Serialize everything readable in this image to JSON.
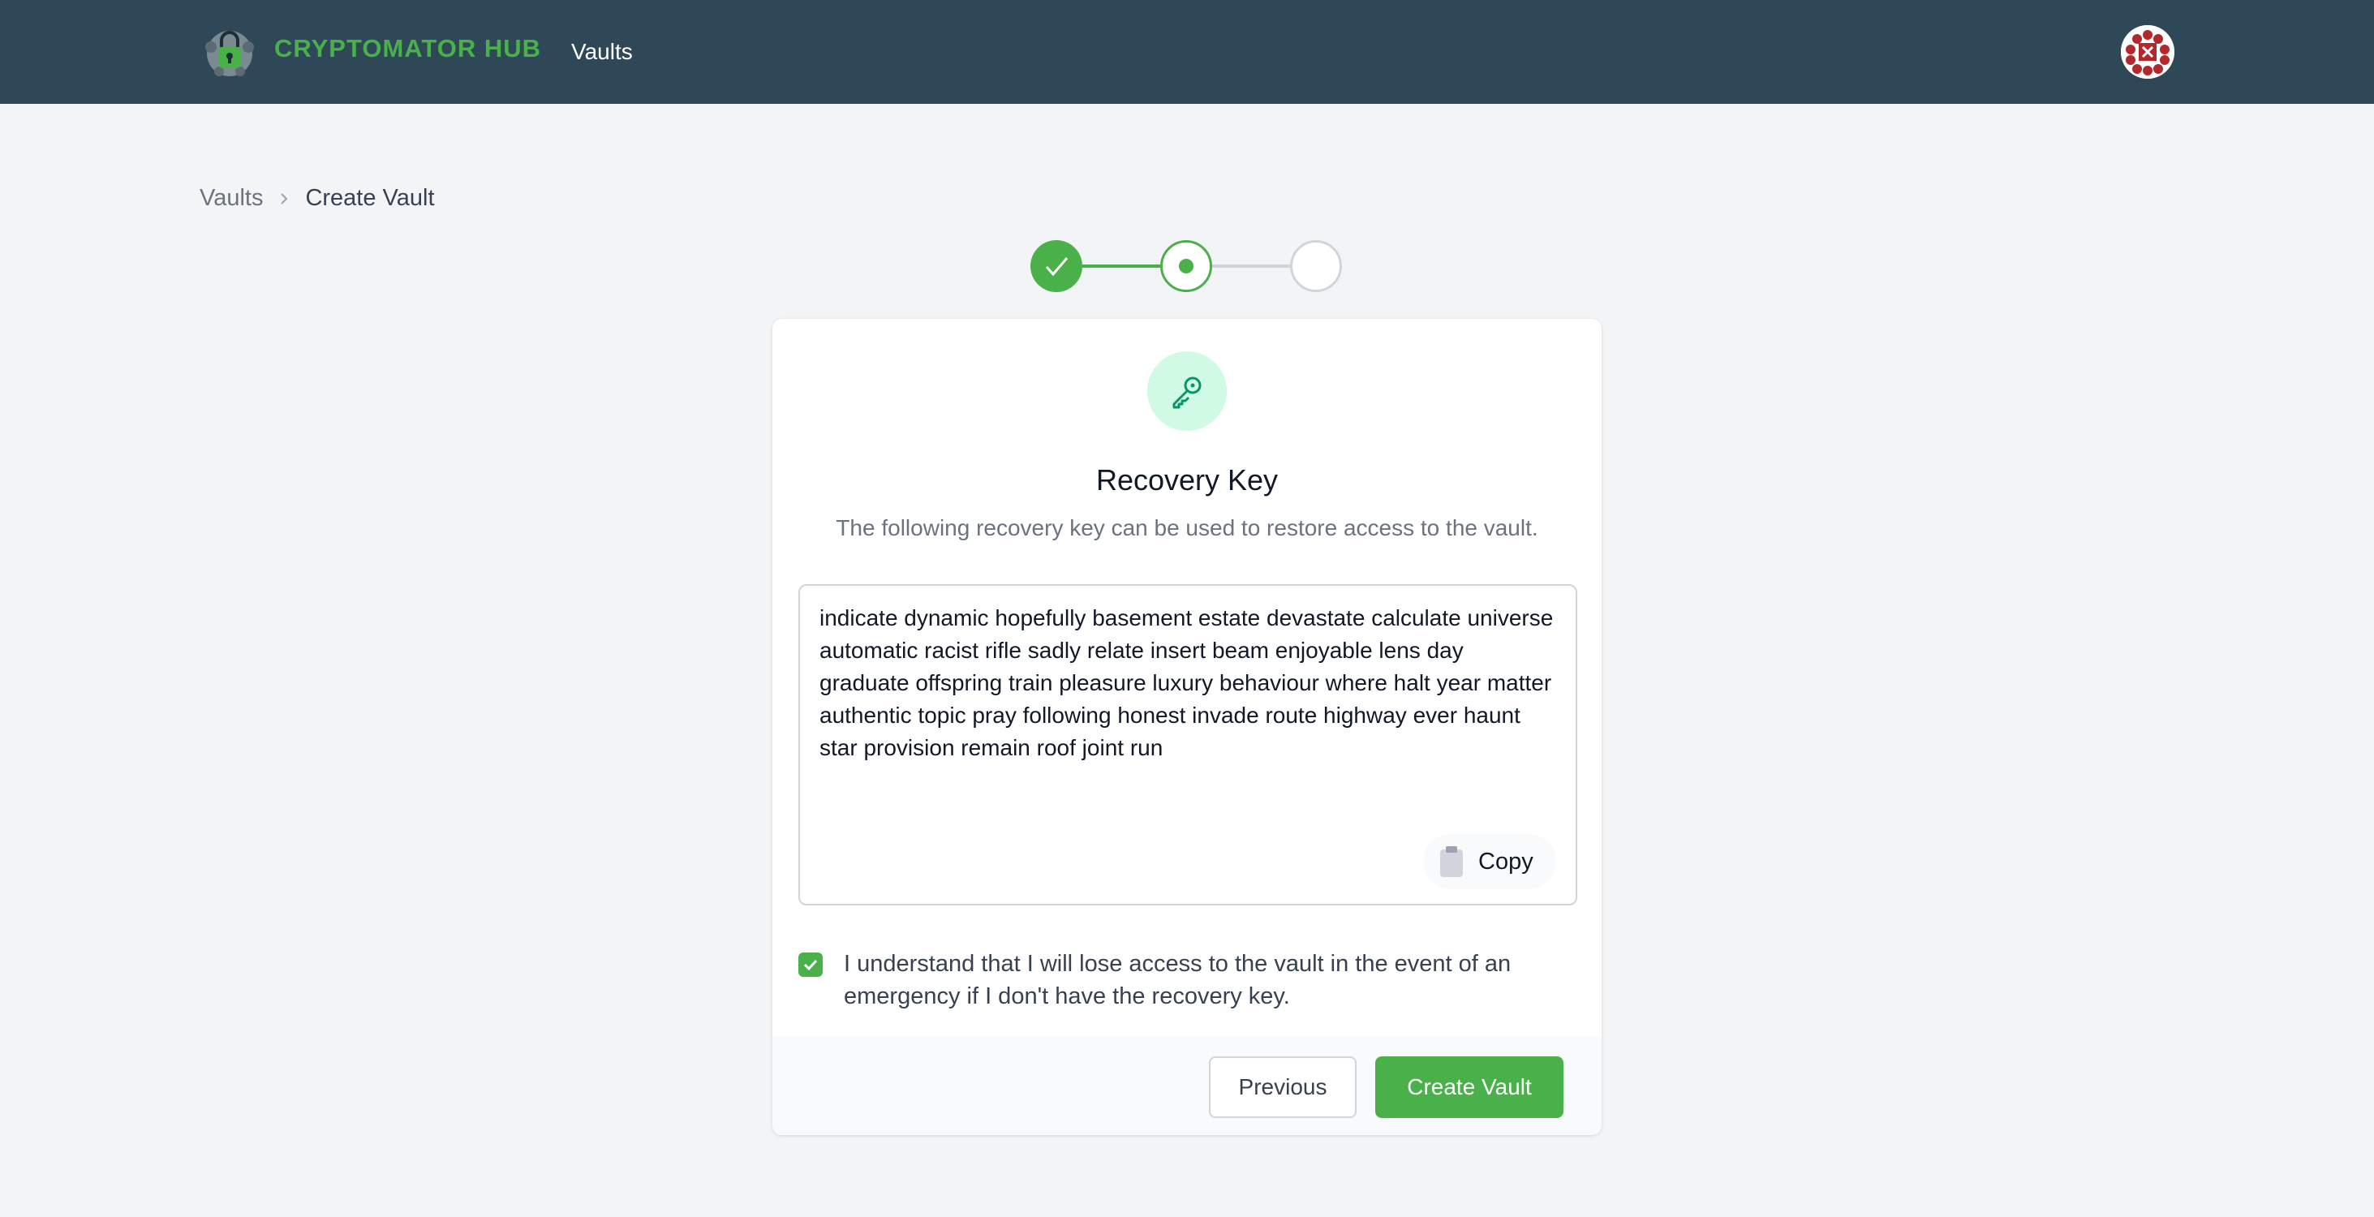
{
  "header": {
    "brand": "CRYPTOMATOR HUB",
    "nav_vaults": "Vaults",
    "brand_color": "#49b04a",
    "bar_color": "#2f4858"
  },
  "breadcrumb": {
    "items": [
      "Vaults",
      "Create Vault"
    ]
  },
  "stepper": {
    "steps": [
      "complete",
      "current",
      "upcoming"
    ]
  },
  "card": {
    "icon": "key-icon",
    "title": "Recovery Key",
    "subtitle": "The following recovery key can be used to restore access to the vault.",
    "recovery_key": "indicate dynamic hopefully basement estate devastate calculate universe automatic racist rifle sadly relate insert beam enjoyable lens day graduate offspring train pleasure luxury behaviour where halt year matter authentic topic pray following honest invade route highway ever haunt star provision remain roof joint run",
    "copy_label": "Copy",
    "consent_checked": true,
    "consent_text": "I understand that I will lose access to the vault in the event of an emergency if I don't have the recovery key.",
    "previous_label": "Previous",
    "create_label": "Create Vault"
  }
}
